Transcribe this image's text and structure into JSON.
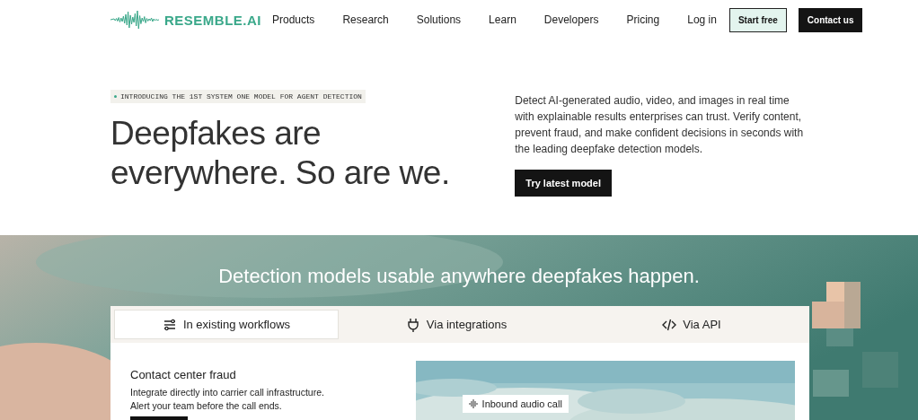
{
  "nav": {
    "logo": "RESEMBLE.AI",
    "links": [
      "Products",
      "Research",
      "Solutions",
      "Learn",
      "Developers",
      "Pricing"
    ],
    "login": "Log in",
    "start": "Start free",
    "contact": "Contact us"
  },
  "hero": {
    "badge": "INTRODUCING THE 1ST SYSTEM ONE MODEL FOR AGENT DETECTION",
    "title": "Deepfakes are everywhere. So are we.",
    "description": "Detect AI-generated audio, video, and images in real time with explainable results enterprises can trust. Verify content, prevent fraud, and make confident decisions in seconds with the leading deepfake detection models.",
    "button": "Try latest model"
  },
  "section": {
    "heading": "Detection models usable anywhere deepfakes happen.",
    "tabs": [
      {
        "label": "In existing workflows",
        "kind": "sliders",
        "selected": true
      },
      {
        "label": "Via integrations",
        "kind": "plug",
        "selected": false
      },
      {
        "label": "Via API",
        "kind": "code",
        "selected": false
      }
    ],
    "panel": {
      "title": "Contact center fraud",
      "text": "Integrate directly into carrier call infrastructure. Alert your team before the call ends.",
      "media": {
        "kind": "picture",
        "tag": "Inbound audio call"
      }
    }
  }
}
